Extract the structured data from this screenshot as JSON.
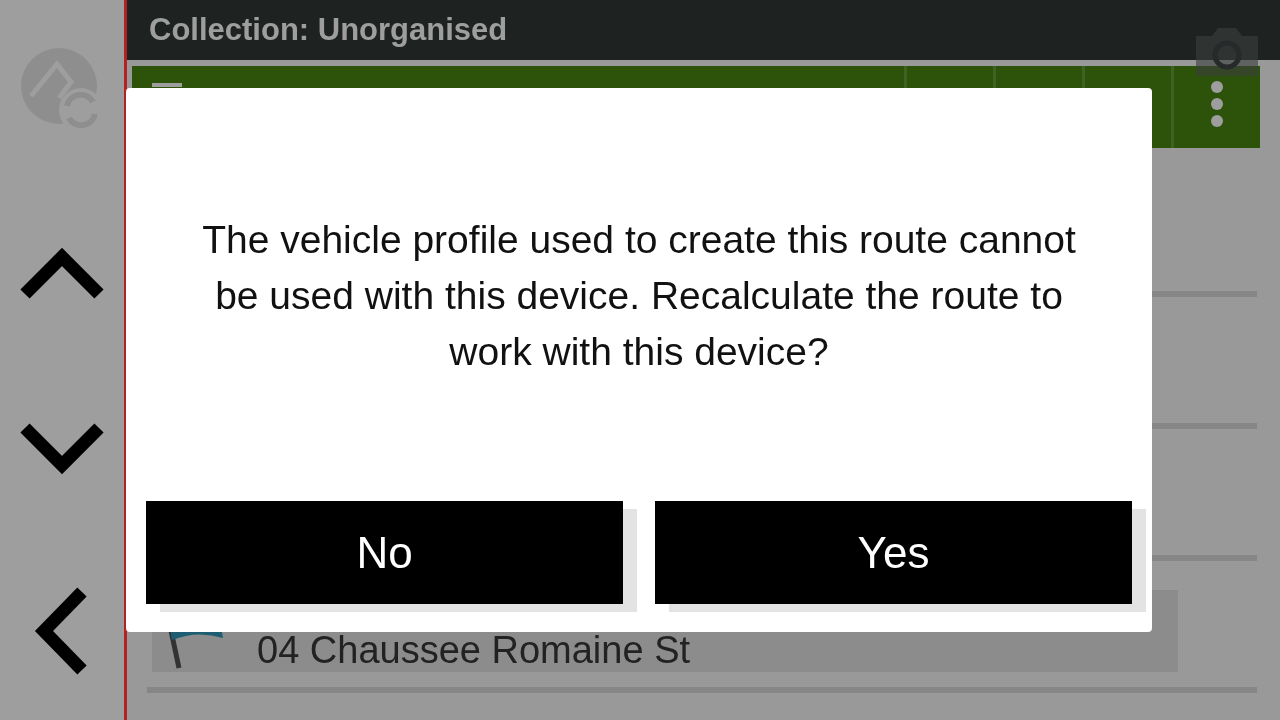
{
  "header": {
    "title": "Collection: Unorganised"
  },
  "list": {
    "rows": [
      {
        "label": ""
      },
      {
        "label": ""
      },
      {
        "label": ""
      },
      {
        "label": "04 Chaussee Romaine St",
        "kind": "flag"
      }
    ]
  },
  "dialog": {
    "message": "The vehicle profile used to create this route cannot be used with this device. Recalculate the route to work with this device?",
    "buttons": [
      {
        "label": "No"
      },
      {
        "label": "Yes"
      }
    ]
  }
}
